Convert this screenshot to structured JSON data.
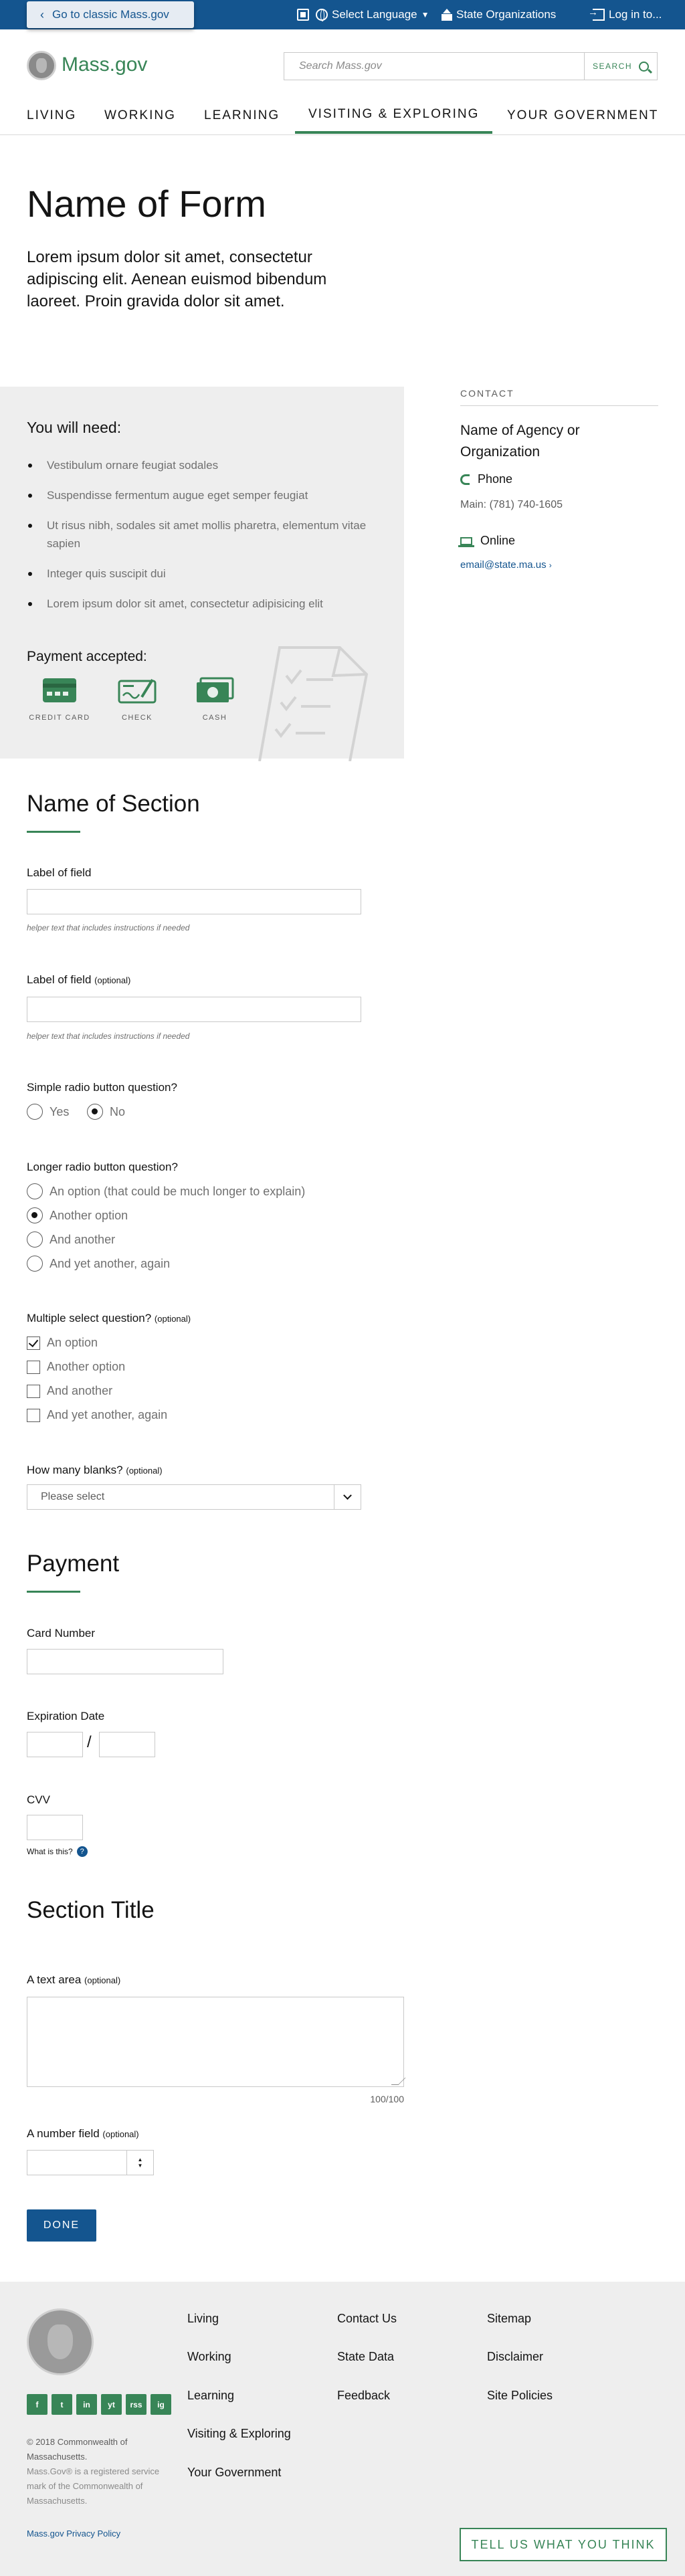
{
  "topbar": {
    "classic_link": "Go to classic Mass.gov",
    "language": "Select Language",
    "state_orgs": "State Organizations",
    "login": "Log in to..."
  },
  "header": {
    "logo_text": "Mass.gov",
    "search_placeholder": "Search Mass.gov",
    "search_button": "SEARCH"
  },
  "nav": {
    "items": [
      "LIVING",
      "WORKING",
      "LEARNING",
      "VISITING & EXPLORING",
      "YOUR GOVERNMENT"
    ],
    "active": "VISITING & EXPLORING"
  },
  "page": {
    "title": "Name of Form",
    "lede": "Lorem ipsum dolor sit amet, consectetur adipiscing elit. Aenean euismod bibendum laoreet. Proin gravida dolor sit amet."
  },
  "need": {
    "title": "You will need:",
    "items": [
      "Vestibulum ornare feugiat sodales",
      "Suspendisse fermentum augue eget semper feugiat",
      "Ut risus nibh, sodales sit amet mollis pharetra, elementum vitae sapien",
      "Integer quis suscipit dui",
      "Lorem ipsum dolor sit amet, consectetur adipisicing elit"
    ],
    "payment_title": "Payment accepted:",
    "payment_methods": [
      "CREDIT CARD",
      "CHECK",
      "CASH"
    ]
  },
  "contact": {
    "heading": "CONTACT",
    "org_name": "Name of Agency or Organization",
    "phone_label": "Phone",
    "phone_main": "Main: (781) 740-1605",
    "online_label": "Online",
    "email": "email@state.ma.us"
  },
  "section1": {
    "title": "Name of Section",
    "field1_label": "Label of field",
    "field1_helper": "helper text that includes instructions if needed",
    "field2_label": "Label of field",
    "field2_opt": "(optional)",
    "field2_helper": "helper text that includes instructions if needed",
    "simple_radio_label": "Simple radio button question?",
    "simple_radio_options": [
      "Yes",
      "No"
    ],
    "simple_radio_selected": "No",
    "long_radio_label": "Longer radio button question?",
    "long_radio_options": [
      "An option (that could be much longer to explain)",
      "Another option",
      "And another",
      "And yet another, again"
    ],
    "long_radio_selected": "Another option",
    "multi_label": "Multiple select question?",
    "multi_opt": "(optional)",
    "multi_options": [
      "An option",
      "Another option",
      "And another",
      "And yet another, again"
    ],
    "multi_checked": [
      "An option"
    ],
    "blanks_label": "How many blanks?",
    "blanks_opt": "(optional)",
    "blanks_value": "Please select"
  },
  "payment": {
    "title": "Payment",
    "card_label": "Card Number",
    "exp_label": "Expiration Date",
    "exp_sep": "/",
    "cvv_label": "CVV",
    "whatis": "What is this?",
    "help_glyph": "?"
  },
  "section2": {
    "title": "Section Title",
    "textarea_label": "A text area",
    "textarea_opt": "(optional)",
    "counter": "100/100",
    "number_label": "A number field",
    "number_opt": "(optional)",
    "done": "DONE"
  },
  "footer": {
    "social": [
      "f",
      "t",
      "in",
      "yt",
      "rss",
      "ig"
    ],
    "copyright": "© 2018 Commonwealth of Massachusetts.",
    "trademark": "Mass.Gov® is a registered service mark of the Commonwealth of Massachusetts.",
    "privacy": "Mass.gov Privacy Policy",
    "col1": [
      "Living",
      "Working",
      "Learning",
      "Visiting & Exploring",
      "Your Government"
    ],
    "col2": [
      "Contact Us",
      "State Data",
      "Feedback"
    ],
    "col3": [
      "Sitemap",
      "Disclaimer",
      "Site Policies"
    ],
    "feedback_button": "TELL US WHAT YOU THINK"
  },
  "colors": {
    "brand_blue": "#14558f",
    "brand_green": "#388557",
    "panel_gray": "#eeeeee"
  }
}
